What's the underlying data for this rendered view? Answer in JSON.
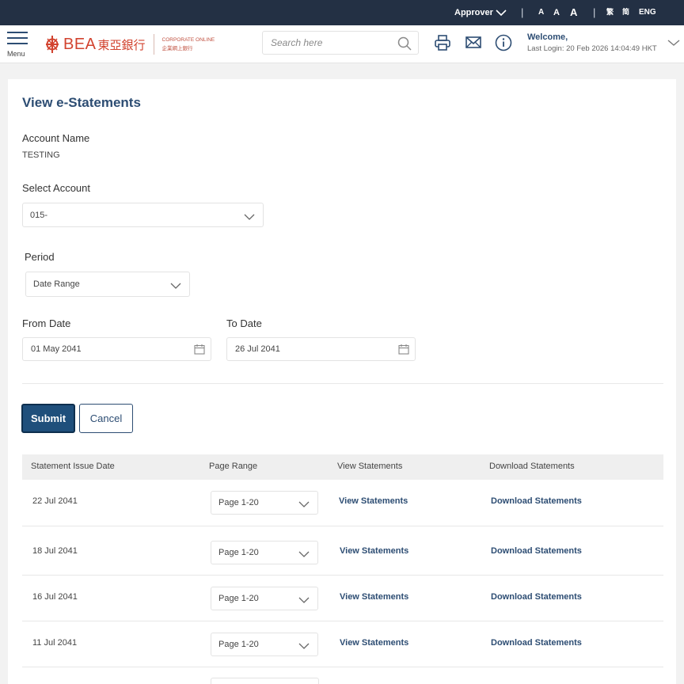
{
  "topbar": {
    "role": "Approver",
    "font_sizes": [
      "A",
      "A",
      "A"
    ],
    "languages": [
      "繁",
      "简",
      "ENG"
    ]
  },
  "header": {
    "menu_label": "Menu",
    "logo": {
      "brand": "BEA",
      "brand_cn": "東亞銀行",
      "sub_en": "CORPORATE ONLINE",
      "sub_cn": "企業網上銀行"
    },
    "search_placeholder": "Search here",
    "welcome": "Welcome,",
    "last_login": "Last Login: 20 Feb 2026 14:04:49 HKT"
  },
  "page": {
    "title": "View e-Statements",
    "account_name_label": "Account Name",
    "account_name_value": "TESTING",
    "select_account_label": "Select Account",
    "select_account_value": "015-",
    "period_label": "Period",
    "period_value": "Date Range",
    "from_date_label": "From Date",
    "from_date_value": "01 May 2041",
    "to_date_label": "To Date",
    "to_date_value": "26 Jul 2041",
    "submit_label": "Submit",
    "cancel_label": "Cancel"
  },
  "table": {
    "headers": [
      "Statement Issue Date",
      "Page Range",
      "View Statements",
      "Download Statements"
    ],
    "rows": [
      {
        "date": "22 Jul 2041",
        "page_range": "Page 1-20",
        "view": "View Statements",
        "download": "Download Statements"
      },
      {
        "date": "18 Jul 2041",
        "page_range": "Page 1-20",
        "view": "View Statements",
        "download": "Download Statements"
      },
      {
        "date": "16 Jul 2041",
        "page_range": "Page 1-20",
        "view": "View Statements",
        "download": "Download Statements"
      },
      {
        "date": "11 Jul 2041",
        "page_range": "Page 1-20",
        "view": "View Statements",
        "download": "Download Statements"
      }
    ]
  },
  "colors": {
    "topbar": "#233044",
    "brand": "#d2432f",
    "accent": "#2d4d73",
    "submit": "#1f4f7b"
  },
  "icons": [
    "chevron-down-icon",
    "search-icon",
    "print-icon",
    "mail-icon",
    "info-icon",
    "calendar-icon",
    "bea-emblem-icon"
  ]
}
